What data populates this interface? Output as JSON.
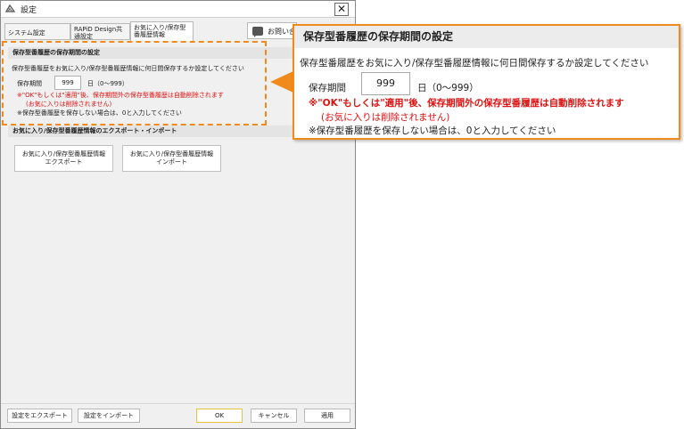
{
  "window": {
    "title": "設定",
    "close_glyph": "✕"
  },
  "tabs": [
    {
      "label": "システム設定"
    },
    {
      "label": "RAPiD Design共通設定"
    },
    {
      "label": "お気に入り/保存型番履歴情報"
    }
  ],
  "help": {
    "label": "お問い合"
  },
  "retention_section": {
    "header": "保存型番履歴の保存期間の設定",
    "description": "保存型番履歴をお気に入り/保存型番履歴情報に何日間保存するか設定してください",
    "period_label": "保存期間",
    "period_value": "999",
    "period_unit": "日（0～999）",
    "warning_line1": "※\"OK\"もしくは\"適用\"後、保存期間外の保存型番履歴は自動削除されます",
    "warning_line2": "(お気に入りは削除されません)",
    "note": "※保存型番履歴を保存しない場合は、0と入力してください"
  },
  "export_section": {
    "header": "お気に入り/保存型番履歴情報のエクスポート・インポート",
    "export_button_line1": "お気に入り/保存型番履歴情報",
    "export_button_line2": "エクスポート",
    "import_button_line1": "お気に入り/保存型番履歴情報",
    "import_button_line2": "インポート"
  },
  "footer": {
    "export_settings": "設定をエクスポート",
    "import_settings": "設定をインポート",
    "ok": "OK",
    "cancel": "キャンセル",
    "apply": "適用"
  },
  "callout": {
    "header": "保存型番履歴の保存期間の設定",
    "description": "保存型番履歴をお気に入り/保存型番履歴情報に何日間保存するか設定してください",
    "period_label": "保存期間",
    "period_value": "999",
    "period_unit": "日（0～999）",
    "warning_line1": "※\"OK\"もしくは\"適用\"後、保存期間外の保存型番履歴は自動削除されます",
    "warning_line2": "(お気に入りは削除されません)",
    "note": "※保存型番履歴を保存しない場合は、0と入力してください"
  },
  "colors": {
    "highlight": "#f08a1c",
    "warning": "#e01010",
    "ok_border": "#e9c23c"
  }
}
